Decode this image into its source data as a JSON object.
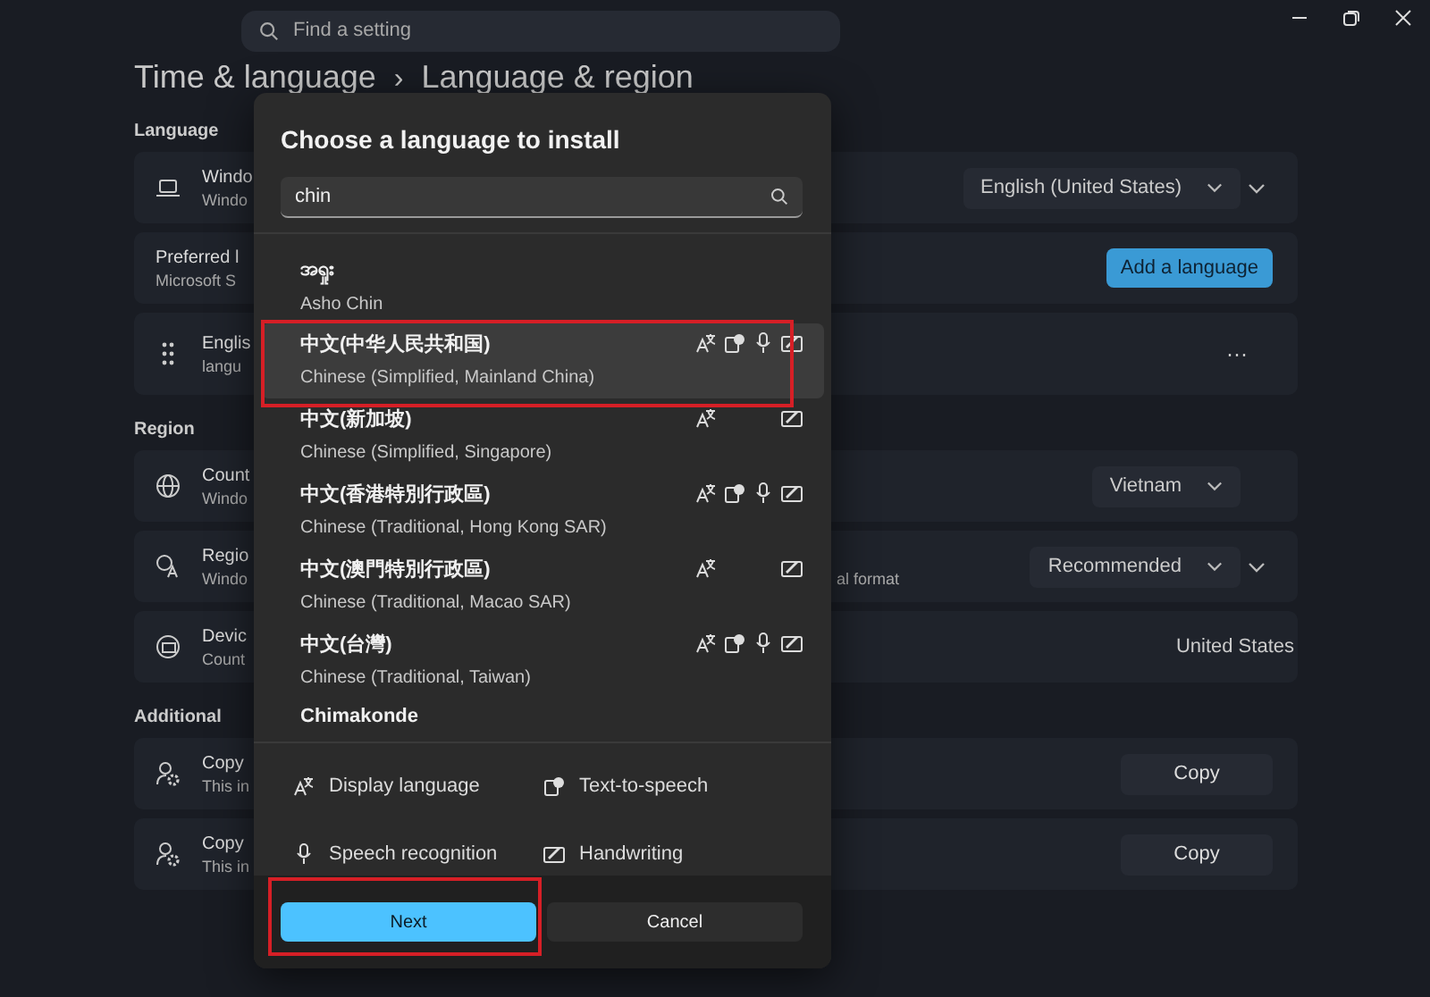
{
  "search": {
    "placeholder": "Find a setting"
  },
  "breadcrumb": {
    "parent": "Time & language",
    "separator": "›",
    "current": "Language & region"
  },
  "sections": [
    {
      "label": "Language",
      "rows": [
        {
          "title": "Windo",
          "subtitle": "Windo",
          "control": {
            "kind": "dropdown",
            "value": "English (United States)"
          },
          "expandable": true
        },
        {
          "title": "Preferred l",
          "subtitle": "Microsoft S",
          "control": {
            "kind": "accent",
            "label": "Add a language"
          },
          "expandable": false
        },
        {
          "title": "Englis",
          "subtitle": "langu",
          "control": {
            "kind": "more",
            "label": "···"
          },
          "expandable": false
        }
      ]
    },
    {
      "label": "Region",
      "rows": [
        {
          "title": "Count",
          "subtitle": "Windo",
          "control": {
            "kind": "dropdown",
            "value": "Vietnam"
          },
          "expandable": false
        },
        {
          "title": "Regio",
          "subtitle": "Windo",
          "subtitle_tail": "al format",
          "control": {
            "kind": "dropdown",
            "value": "Recommended"
          },
          "expandable": true
        },
        {
          "title": "Devic",
          "subtitle": "Count",
          "control": {
            "kind": "text",
            "value": "United States"
          },
          "expandable": false
        }
      ]
    },
    {
      "label": "Additional",
      "rows": [
        {
          "title": "Copy",
          "subtitle": "This in",
          "control": {
            "kind": "button",
            "label": "Copy"
          },
          "expandable": false
        },
        {
          "title": "Copy",
          "subtitle": "This in",
          "control": {
            "kind": "button",
            "label": "Copy"
          },
          "expandable": false
        }
      ]
    }
  ],
  "dialog": {
    "title": "Choose a language to install",
    "search": {
      "value": "chin"
    },
    "languages": [
      {
        "native": "အရှုး",
        "name": "Asho Chin",
        "selected": false,
        "annotated": false,
        "display": false,
        "tts": false,
        "speech": false,
        "handwriting": false
      },
      {
        "native": "中文(中华人民共和国)",
        "name": "Chinese (Simplified, Mainland China)",
        "selected": true,
        "annotated": true,
        "display": true,
        "tts": true,
        "speech": true,
        "handwriting": true
      },
      {
        "native": "中文(新加坡)",
        "name": "Chinese (Simplified, Singapore)",
        "selected": false,
        "annotated": false,
        "display": true,
        "tts": false,
        "speech": false,
        "handwriting": true
      },
      {
        "native": "中文(香港特別行政區)",
        "name": "Chinese (Traditional, Hong Kong SAR)",
        "selected": false,
        "annotated": false,
        "display": true,
        "tts": true,
        "speech": true,
        "handwriting": true
      },
      {
        "native": "中文(澳門特別行政區)",
        "name": "Chinese (Traditional, Macao SAR)",
        "selected": false,
        "annotated": false,
        "display": true,
        "tts": false,
        "speech": false,
        "handwriting": true
      },
      {
        "native": "中文(台灣)",
        "name": "Chinese (Traditional, Taiwan)",
        "selected": false,
        "annotated": false,
        "display": true,
        "tts": true,
        "speech": true,
        "handwriting": true
      },
      {
        "native": "Chimakonde",
        "selected": false,
        "annotated": false,
        "display": false,
        "tts": false,
        "speech": false,
        "handwriting": false
      }
    ],
    "legend": [
      {
        "kind": "display",
        "label": "Display language"
      },
      {
        "kind": "tts",
        "label": "Text-to-speech"
      },
      {
        "kind": "speech",
        "label": "Speech recognition"
      },
      {
        "kind": "handwriting",
        "label": "Handwriting"
      }
    ],
    "buttons": [
      {
        "kind": "primary",
        "label": "Next",
        "annotated": true
      },
      {
        "kind": "secondary",
        "label": "Cancel",
        "annotated": false
      }
    ]
  }
}
